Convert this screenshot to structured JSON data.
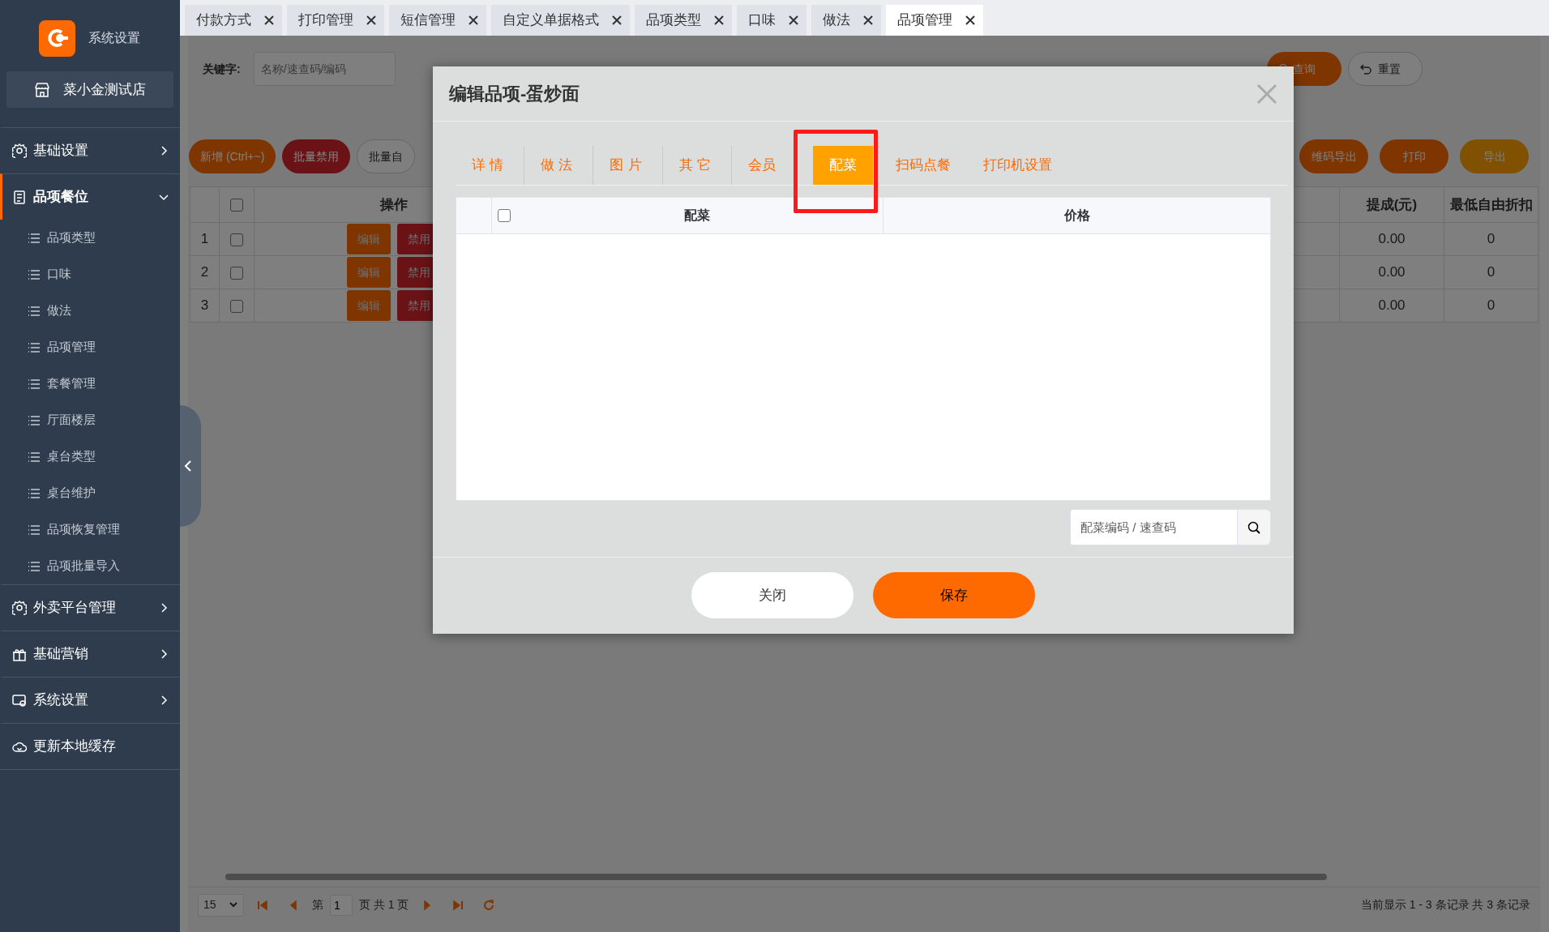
{
  "sidebar": {
    "title": "系统设置",
    "store": "菜小金测试店",
    "menu": [
      {
        "label": "基础设置",
        "selected": false,
        "expanded": false
      },
      {
        "label": "品项餐位",
        "selected": true,
        "expanded": true,
        "children": [
          {
            "label": "品项类型"
          },
          {
            "label": "口味"
          },
          {
            "label": "做法"
          },
          {
            "label": "品项管理"
          },
          {
            "label": "套餐管理"
          },
          {
            "label": "厅面楼层"
          },
          {
            "label": "桌台类型"
          },
          {
            "label": "桌台维护"
          },
          {
            "label": "品项恢复管理"
          },
          {
            "label": "品项批量导入"
          }
        ]
      },
      {
        "label": "外卖平台管理",
        "selected": false,
        "expanded": false
      },
      {
        "label": "基础营销",
        "selected": false,
        "expanded": false
      },
      {
        "label": "系统设置",
        "selected": false,
        "expanded": false
      },
      {
        "label": "更新本地缓存",
        "selected": false
      }
    ]
  },
  "tabs": [
    {
      "label": "付款方式",
      "selected": false
    },
    {
      "label": "打印管理",
      "selected": false
    },
    {
      "label": "短信管理",
      "selected": false
    },
    {
      "label": "自定义单据格式",
      "selected": false
    },
    {
      "label": "品项类型",
      "selected": false
    },
    {
      "label": "口味",
      "selected": false
    },
    {
      "label": "做法",
      "selected": false
    },
    {
      "label": "品项管理",
      "selected": true
    }
  ],
  "filters": {
    "keyword": {
      "label": "关键字:",
      "placeholder": "名称/速查码/编码"
    },
    "search_button": "查询",
    "reset_button": "重置"
  },
  "toolbar": {
    "left": [
      {
        "label": "新增 (Ctrl+~)",
        "kind": "primary"
      },
      {
        "label": "批量禁用",
        "kind": "danger"
      },
      {
        "label": "批量自",
        "kind": "outline"
      }
    ],
    "right": [
      {
        "label": "维码导出",
        "kind": "primary"
      },
      {
        "label": "打印",
        "kind": "primary"
      },
      {
        "label": "导出",
        "kind": "warning"
      }
    ]
  },
  "table": {
    "header_checked": false,
    "columns": [
      {
        "label": "操作"
      },
      {
        "label": "提成(元)"
      },
      {
        "label": "最低自由折扣"
      }
    ],
    "rows": [
      {
        "index": "1",
        "checked": false,
        "actions": [
          "编辑",
          "禁用"
        ],
        "commission": "0.00",
        "min_discount": "0"
      },
      {
        "index": "2",
        "checked": false,
        "actions": [
          "编辑",
          "禁用"
        ],
        "commission": "0.00",
        "min_discount": "0"
      },
      {
        "index": "3",
        "checked": false,
        "actions": [
          "编辑",
          "禁用"
        ],
        "commission": "0.00",
        "min_discount": "0"
      }
    ]
  },
  "pager": {
    "page_size": "15",
    "before": "第",
    "page": "1",
    "after": "页 共 1 页",
    "summary": "当前显示 1 - 3 条记录 共 3 条记录"
  },
  "modal": {
    "title": "编辑品项-蛋炒面",
    "tabs": [
      {
        "label": "详情",
        "selected": false,
        "highlighted": false
      },
      {
        "label": "做法",
        "selected": false,
        "highlighted": false
      },
      {
        "label": "图片",
        "selected": false,
        "highlighted": false
      },
      {
        "label": "其它",
        "selected": false,
        "highlighted": false
      },
      {
        "label": "会员",
        "selected": false,
        "highlighted": false
      },
      {
        "label": "配菜",
        "selected": true,
        "highlighted": true
      },
      {
        "label": "扫码点餐",
        "selected": false,
        "highlighted": false
      },
      {
        "label": "打印机设置",
        "selected": false,
        "highlighted": false
      }
    ],
    "table": {
      "header_checked": false,
      "columns": [
        "配菜",
        "价格"
      ]
    },
    "search": {
      "placeholder": "配菜编码 / 速查码"
    },
    "buttons": [
      {
        "label": "关闭",
        "kind": "default"
      },
      {
        "label": "保存",
        "kind": "primary"
      }
    ]
  }
}
